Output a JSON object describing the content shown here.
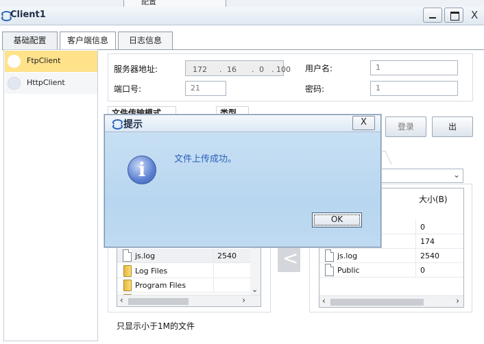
{
  "background_window": {
    "tab_label": "配置"
  },
  "window": {
    "title": "Client1",
    "close_label": "X"
  },
  "tabs": [
    {
      "label": "基础配置"
    },
    {
      "label": "客户端信息"
    },
    {
      "label": "日志信息"
    }
  ],
  "sidebar": {
    "items": [
      {
        "label": "FtpClient",
        "selected": true
      },
      {
        "label": "HttpClient",
        "selected": false
      }
    ]
  },
  "form": {
    "server_label": "服务器地址:",
    "ip_parts": [
      "172",
      ".",
      "16",
      ".",
      "0",
      ".",
      "100"
    ],
    "port_label": "端口号:",
    "port_value": "21",
    "user_label": "用户名:",
    "user_value": "1",
    "password_label": "密码:",
    "password_value": "1",
    "mode_tab_label": "文件传输模式",
    "type_tab_label": "类型"
  },
  "buttons": {
    "login": "登录",
    "logout": "出"
  },
  "local_files": {
    "rows": [
      {
        "name": "js.log",
        "size": "2540",
        "icon": "file-icon"
      },
      {
        "name": "Log Files",
        "size": "",
        "icon": "folder-icon"
      },
      {
        "name": "Program Files",
        "size": "",
        "icon": "folder-icon"
      }
    ]
  },
  "remote_files": {
    "size_header": "大小(B)",
    "rows": [
      {
        "name": "",
        "size": "0",
        "icon": ""
      },
      {
        "name": "",
        "size": "174",
        "icon": ""
      },
      {
        "name": "js.log",
        "size": "2540",
        "icon": "file-icon"
      },
      {
        "name": "Public",
        "size": "0",
        "icon": "file-icon"
      }
    ]
  },
  "transfer": {
    "arrow": "<"
  },
  "note": "只显示小于1M的文件",
  "dialog": {
    "title": "提示",
    "close_label": "X",
    "message": "文件上传成功。",
    "ok_label": "OK"
  },
  "colors": {
    "selected_item": "#ffe28a",
    "dialog_body": "#c7dff3",
    "message_text": "#2a5dbb"
  }
}
